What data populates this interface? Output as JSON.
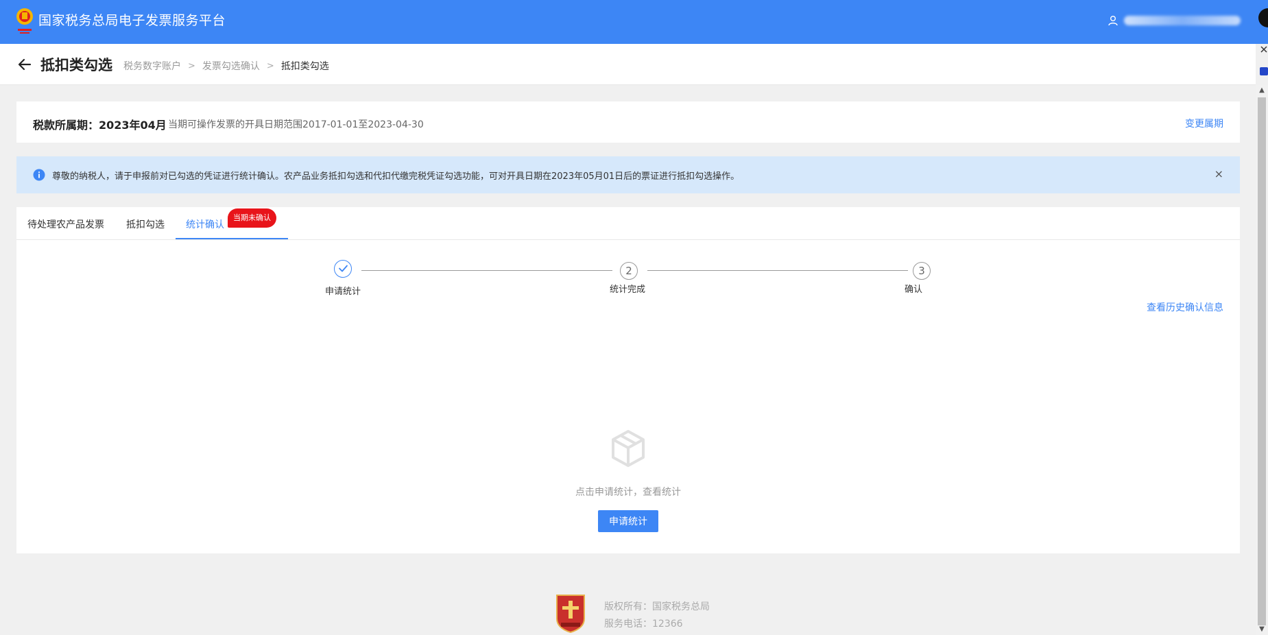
{
  "header": {
    "app_title": "国家税务总局电子发票服务平台"
  },
  "subheader": {
    "page_title": "抵扣类勾选",
    "breadcrumb": [
      "税务数字账户",
      "发票勾选确认",
      "抵扣类勾选"
    ]
  },
  "period": {
    "label": "税款所属期：",
    "value": "2023年04月",
    "range_text": "当期可操作发票的开具日期范围2017-01-01至2023-04-30",
    "change_label": "变更属期"
  },
  "notice": {
    "text": "尊敬的纳税人，请于申报前对已勾选的凭证进行统计确认。农产品业务抵扣勾选和代扣代缴完税凭证勾选功能，可对开具日期在2023年05月01日后的票证进行抵扣勾选操作。",
    "close_symbol": "×"
  },
  "tabs": [
    {
      "label": "待处理农产品发票"
    },
    {
      "label": "抵扣勾选"
    },
    {
      "label": "统计确认",
      "badge": "当期未确认"
    }
  ],
  "steps": [
    {
      "label": "申请统计",
      "number": "",
      "status": "done"
    },
    {
      "label": "统计完成",
      "number": "2",
      "status": "pending"
    },
    {
      "label": "确认",
      "number": "3",
      "status": "pending"
    }
  ],
  "history_link": "查看历史确认信息",
  "empty_state": {
    "message": "点击申请统计，查看统计",
    "button_label": "申请统计"
  },
  "footer": {
    "copyright": "版权所有：国家税务总局",
    "phone": "服务电话：12366"
  },
  "colors": {
    "primary": "#3d86f5",
    "badge": "#e8141a",
    "notice_bg": "#d6e8fb"
  },
  "icons": [
    "tax-emblem-icon",
    "user-icon",
    "back-arrow-icon",
    "info-icon",
    "close-icon",
    "check-icon",
    "empty-box-icon",
    "footer-emblem-icon"
  ]
}
